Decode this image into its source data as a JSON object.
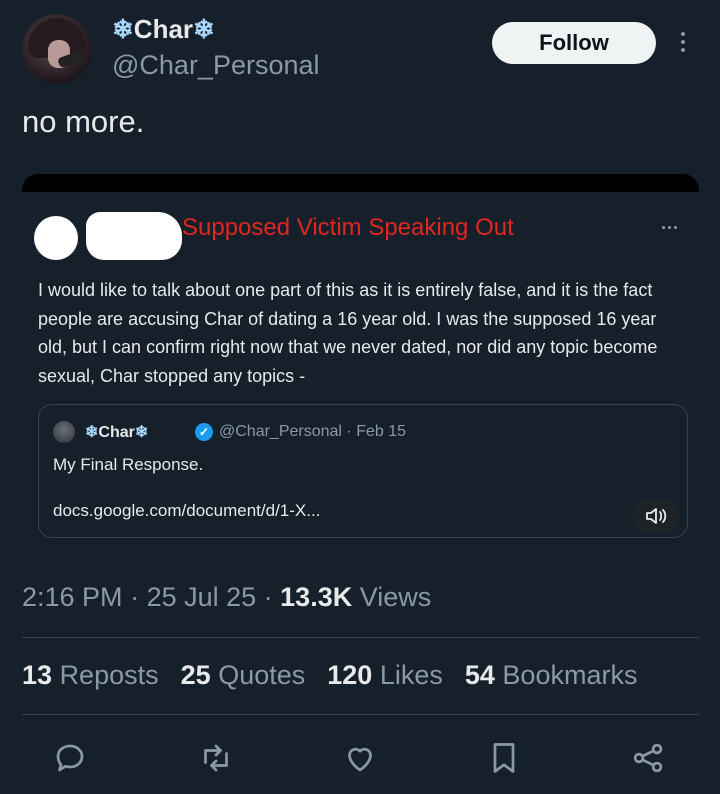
{
  "user": {
    "display_name": "Char",
    "handle": "@Char_Personal"
  },
  "follow_label": "Follow",
  "tweet_text": "no more.",
  "media": {
    "overlay_title": "Supposed Victim Speaking Out",
    "quote_body": "I would like to talk about one part of this as it is entirely false, and it is the fact people are accusing Char of dating a 16 year old. I was the supposed 16 year old, but I can confirm right now that we never dated, nor did any topic become sexual, Char stopped any topics -",
    "inner_quote": {
      "name": "Char",
      "handle_date": "@Char_Personal · Feb 15",
      "text": "My Final Response.",
      "link": "docs.google.com/document/d/1-X..."
    }
  },
  "meta": {
    "time": "2:16 PM",
    "date": "25 Jul 25",
    "views_count": "13.3K",
    "views_label": "Views"
  },
  "stats": {
    "reposts_count": "13",
    "reposts_label": "Reposts",
    "quotes_count": "25",
    "quotes_label": "Quotes",
    "likes_count": "120",
    "likes_label": "Likes",
    "bookmarks_count": "54",
    "bookmarks_label": "Bookmarks"
  },
  "icons": [
    "reply-icon",
    "repost-icon",
    "like-icon",
    "bookmark-icon",
    "share-icon",
    "more-icon",
    "sound-icon",
    "verified-icon",
    "snowflake-icon"
  ],
  "colors": {
    "background": "#15202b",
    "text": "#e7e9ea",
    "secondary": "#8b98a5",
    "accent": "#1d9bf0",
    "overlay_title": "#e0261e"
  }
}
